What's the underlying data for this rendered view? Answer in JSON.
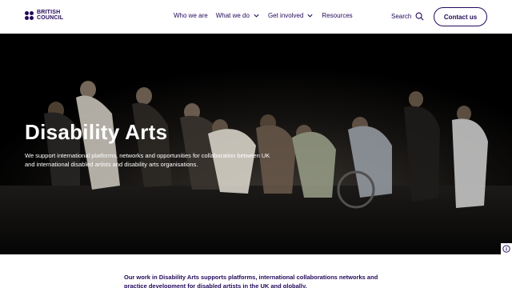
{
  "brand": {
    "line1": "BRITISH",
    "line2": "COUNCIL"
  },
  "nav": [
    {
      "label": "Who we are",
      "dropdown": false
    },
    {
      "label": "What we do",
      "dropdown": true
    },
    {
      "label": "Get involved",
      "dropdown": true
    },
    {
      "label": "Resources",
      "dropdown": false
    }
  ],
  "search": {
    "label": "Search",
    "icon": "search-icon"
  },
  "contact": {
    "label": "Contact us"
  },
  "hero": {
    "title": "Disability Arts",
    "description": "We support international platforms, networks and opportunities for collaboration between UK and international disabled artists and disability arts organisations."
  },
  "intro": {
    "text": "Our work in Disability Arts supports platforms, international collaborations networks and practice development for disabled artists in the UK and globally."
  },
  "colors": {
    "brand": "#23085a",
    "hero_bg": "#000000",
    "text_on_hero": "#ffffff"
  }
}
